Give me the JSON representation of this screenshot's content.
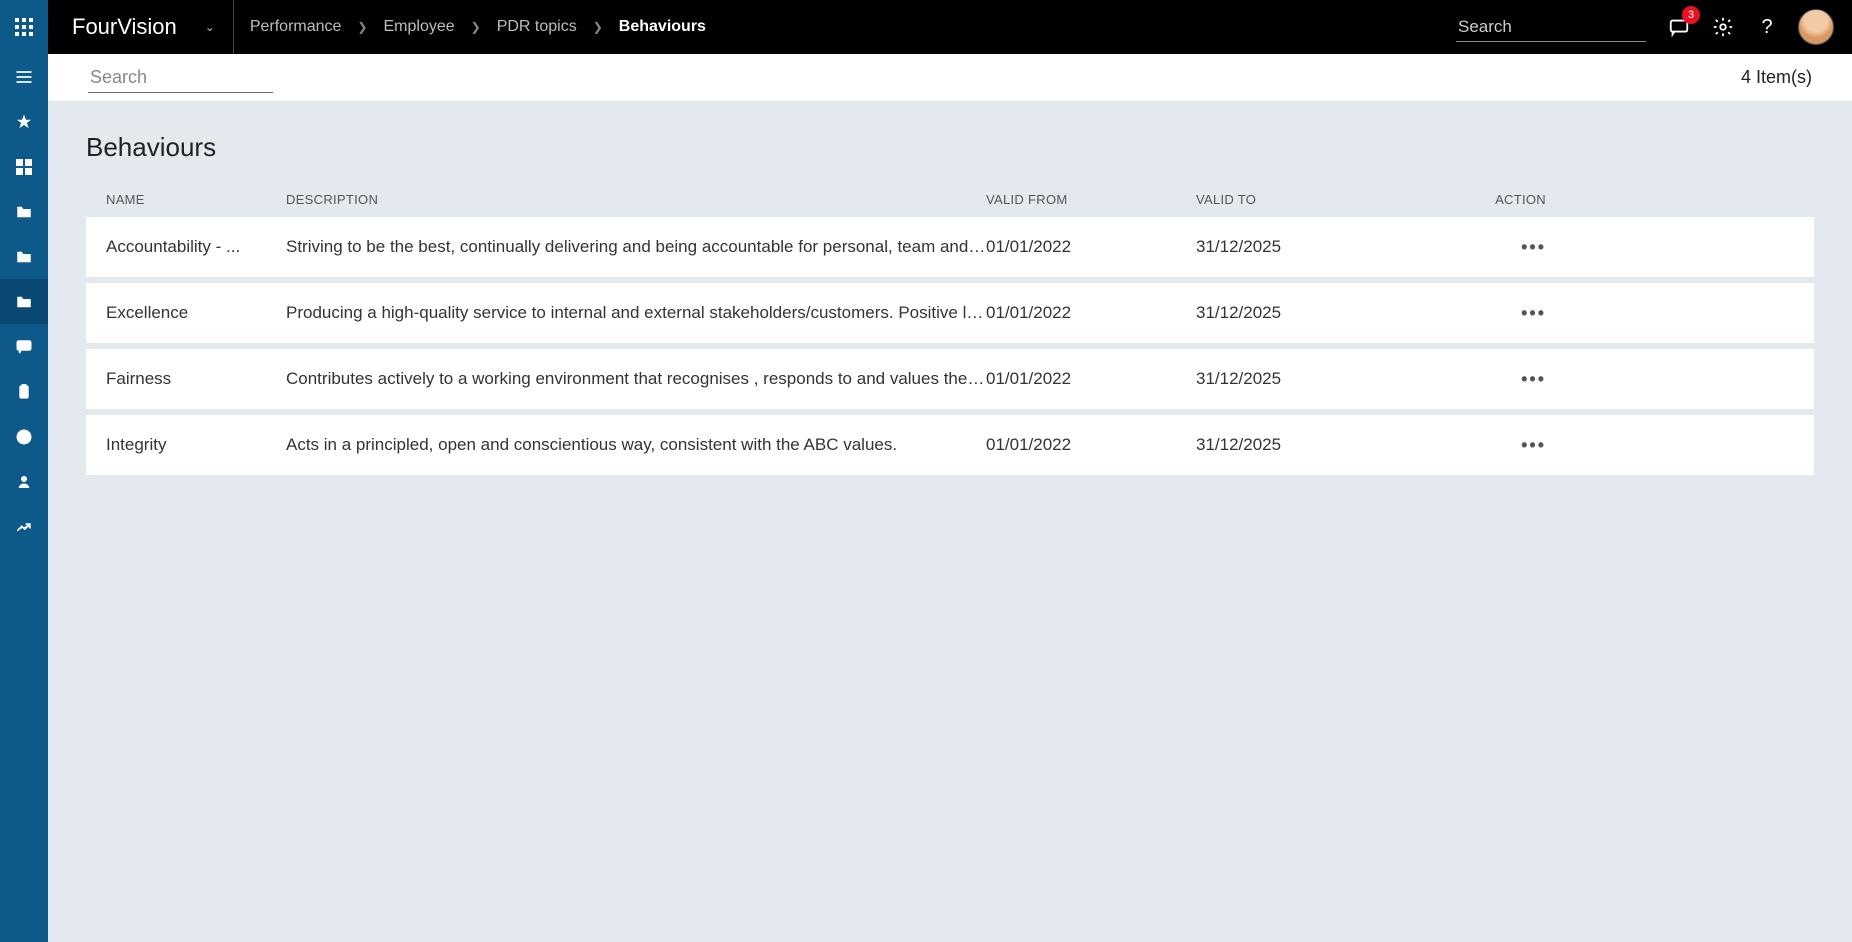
{
  "header": {
    "brand": "FourVision",
    "search_placeholder": "Search",
    "notification_count": "3",
    "breadcrumbs": [
      {
        "label": "Performance",
        "active": false
      },
      {
        "label": "Employee",
        "active": false
      },
      {
        "label": "PDR topics",
        "active": false
      },
      {
        "label": "Behaviours",
        "active": true
      }
    ]
  },
  "toolbar": {
    "search_placeholder": "Search",
    "item_count_text": "4 Item(s)"
  },
  "page": {
    "title": "Behaviours"
  },
  "table": {
    "columns": {
      "name": "NAME",
      "description": "DESCRIPTION",
      "valid_from": "VALID FROM",
      "valid_to": "VALID TO",
      "action": "ACTION"
    },
    "rows": [
      {
        "name": "Accountability - ...",
        "description": "Striving to be the best, continually delivering and being accountable for personal, team and …",
        "valid_from": "01/01/2022",
        "valid_to": "31/12/2025"
      },
      {
        "name": "Excellence",
        "description": "Producing a high-quality service to internal and external stakeholders/customers. Positive lo…",
        "valid_from": "01/01/2022",
        "valid_to": "31/12/2025"
      },
      {
        "name": "Fairness",
        "description": "Contributes actively to a working environment that recognises , responds to and values the c…",
        "valid_from": "01/01/2022",
        "valid_to": "31/12/2025"
      },
      {
        "name": "Integrity",
        "description": "Acts in a principled, open and conscientious way, consistent with the ABC values.",
        "valid_from": "01/01/2022",
        "valid_to": "31/12/2025"
      }
    ]
  }
}
